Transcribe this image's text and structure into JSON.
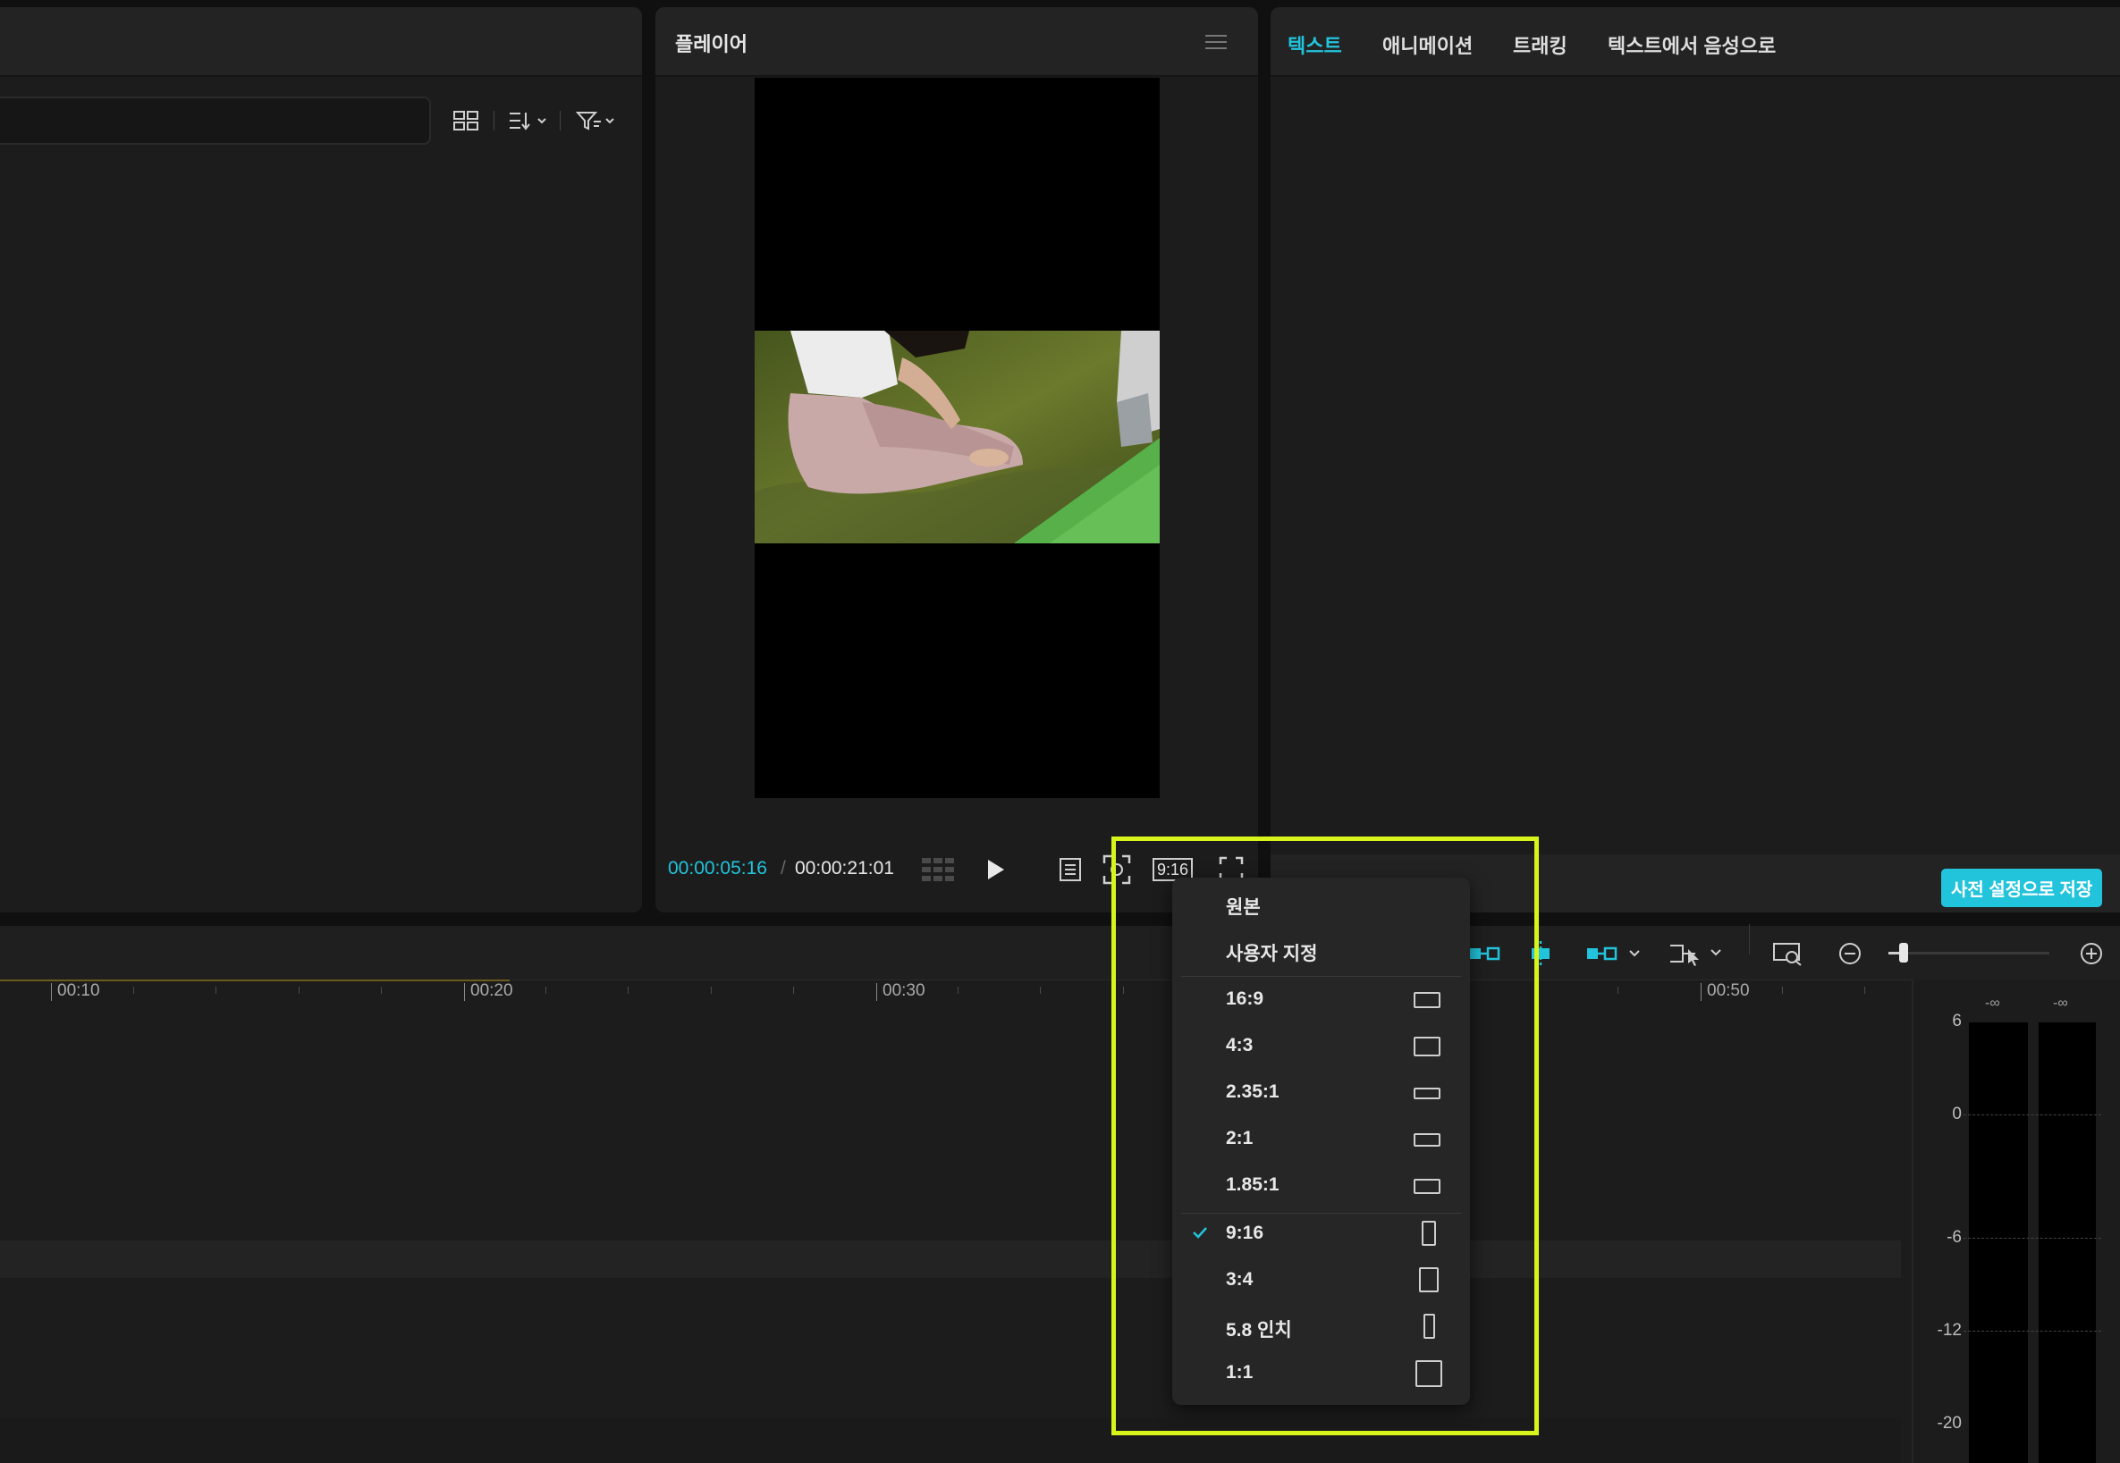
{
  "player": {
    "title": "플레이어",
    "time_current": "00:00:05:16",
    "time_separator": "/",
    "time_total": "00:00:21:01",
    "ratio_button": "9:16"
  },
  "inspector": {
    "tabs": [
      {
        "label": "텍스트",
        "active": true
      },
      {
        "label": "애니메이션",
        "active": false
      },
      {
        "label": "트래킹",
        "active": false
      },
      {
        "label": "텍스트에서 음성으로",
        "active": false
      }
    ],
    "save_preset_button": "사전 설정으로 저장"
  },
  "timeline": {
    "ruler": [
      "00:10",
      "00:20",
      "00:30",
      "00:50"
    ]
  },
  "audio_meter": {
    "db_labels": [
      "6",
      "0",
      "-6",
      "-12",
      "-20"
    ],
    "channel_peaks": [
      "-∞",
      "-∞"
    ]
  },
  "ratio_menu": {
    "items": [
      {
        "label": "원본",
        "selected": false
      },
      {
        "label": "사용자 지정",
        "selected": false
      },
      {
        "label": "16:9",
        "selected": false,
        "icon": "landscape-16-9-icon"
      },
      {
        "label": "4:3",
        "selected": false,
        "icon": "landscape-4-3-icon"
      },
      {
        "label": "2.35:1",
        "selected": false,
        "icon": "cinema-wide-icon"
      },
      {
        "label": "2:1",
        "selected": false,
        "icon": "wide-2-1-icon"
      },
      {
        "label": "1.85:1",
        "selected": false,
        "icon": "wide-1-85-icon"
      },
      {
        "label": "9:16",
        "selected": true,
        "icon": "portrait-9-16-icon"
      },
      {
        "label": "3:4",
        "selected": false,
        "icon": "portrait-3-4-icon"
      },
      {
        "label": "5.8 인치",
        "selected": false,
        "icon": "phone-5-8-icon"
      },
      {
        "label": "1:1",
        "selected": false,
        "icon": "square-icon"
      }
    ]
  },
  "colors": {
    "accent": "#22c4dc",
    "highlight_box": "#d7f51b",
    "background": "#101010",
    "panel": "#1c1c1c"
  }
}
